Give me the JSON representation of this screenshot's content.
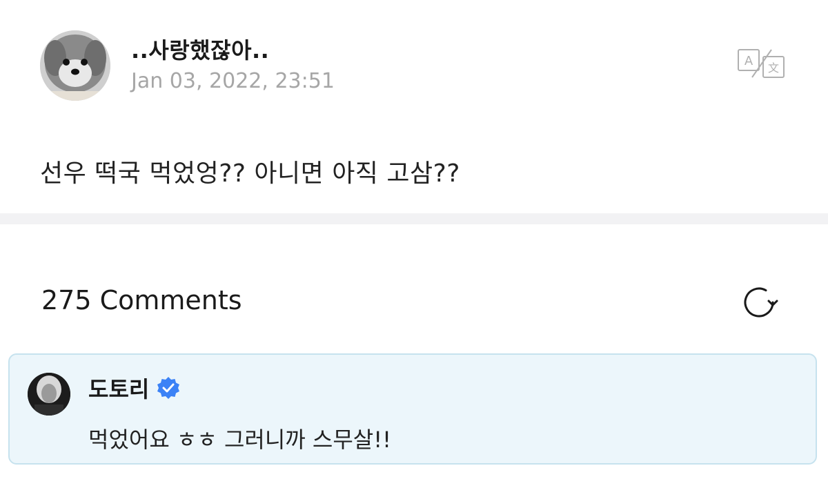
{
  "post": {
    "author": "..사랑했잖아..",
    "timestamp": "Jan 03, 2022, 23:51",
    "body": "선우 떡국 먹었엉?? 아니면 아직 고삼??",
    "translate_icon": "translate-icon"
  },
  "comments": {
    "count_label": "275 Comments",
    "refresh_icon": "refresh-icon",
    "items": [
      {
        "author": "도토리",
        "verified": true,
        "text": "먹었어요 ㅎㅎ 그러니까 스무살!!"
      }
    ]
  },
  "colors": {
    "comment_bg": "#ecf6fb",
    "comment_border": "#c6e2ee",
    "verified_blue": "#3b82f6",
    "timestamp_gray": "#a6a6a6",
    "divider": "#f2f2f4"
  }
}
